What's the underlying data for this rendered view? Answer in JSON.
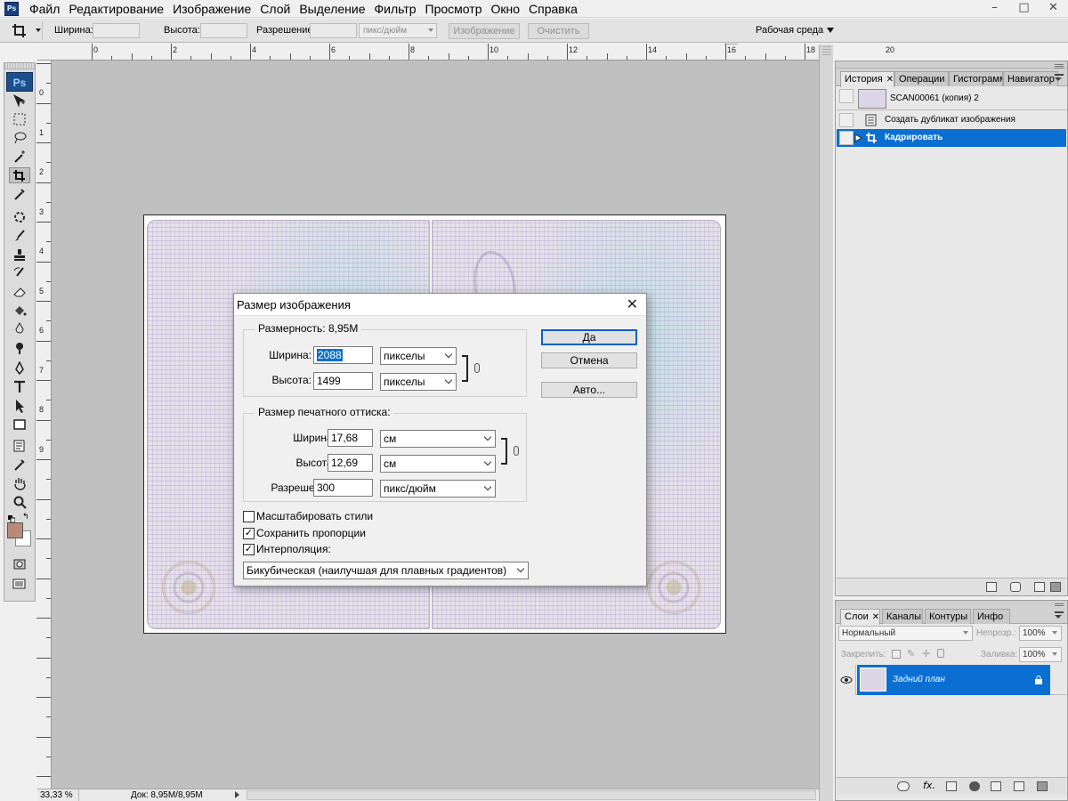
{
  "menubar": {
    "items": [
      "Файл",
      "Редактирование",
      "Изображение",
      "Слой",
      "Выделение",
      "Фильтр",
      "Просмотр",
      "Окно",
      "Справка"
    ],
    "win_minimize": "–",
    "win_restore": "□",
    "win_close": "✕"
  },
  "options": {
    "width_label": "Ширина:",
    "height_label": "Высота:",
    "resolution_label": "Разрешение:",
    "resolution_unit": "пикс/дюйм",
    "image_button": "Изображение",
    "clear_button": "Очистить",
    "workspace": "Рабочая среда"
  },
  "ruler": {
    "top_numbers": [
      "0",
      "2",
      "4",
      "6",
      "8",
      "10",
      "12",
      "14",
      "16",
      "18",
      "20"
    ],
    "left_numbers": [
      "0",
      "1",
      "2",
      "3",
      "4",
      "5",
      "6",
      "7",
      "8",
      "9"
    ]
  },
  "status": {
    "zoom": "33,33 %",
    "doc": "Док: 8,95M/8,95M"
  },
  "history": {
    "tabs": [
      "История",
      "Операции",
      "Гистограмма",
      "Навигатор"
    ],
    "snapshot": "SCAN00061 (копия) 2",
    "steps": [
      "Создать дубликат изображения",
      "Кадрировать"
    ]
  },
  "layers": {
    "tabs": [
      "Слои",
      "Каналы",
      "Контуры",
      "Инфо"
    ],
    "blend_mode": "Нормальный",
    "opacity_label": "Непрозр.:",
    "opacity": "100%",
    "lock_label": "Закрепить:",
    "fill_label": "Заливка:",
    "fill": "100%",
    "layer_name": "Задний план"
  },
  "dialog": {
    "title": "Размер изображения",
    "dimensions_label": "Размерность:",
    "dimensions_size": "8,95M",
    "pixel_width_label": "Ширина:",
    "pixel_width": "2088",
    "pixel_width_unit": "пикселы",
    "pixel_height_label": "Высота:",
    "pixel_height": "1499",
    "pixel_height_unit": "пикселы",
    "print_group": "Размер печатного оттиска:",
    "doc_width_label": "Ширина:",
    "doc_width": "17,68",
    "doc_width_unit": "см",
    "doc_height_label": "Высота:",
    "doc_height": "12,69",
    "doc_height_unit": "см",
    "resolution_label": "Разрешение:",
    "resolution": "300",
    "resolution_unit": "пикс/дюйм",
    "scale_styles": "Масштабировать стили",
    "constrain": "Сохранить пропорции",
    "resample": "Интерполяция:",
    "resample_method": "Бикубическая (наилучшая для плавных градиентов)",
    "ok": "Да",
    "cancel": "Отмена",
    "auto": "Авто...",
    "check_mark": "✓"
  },
  "toolbox": {
    "badge": "Ps"
  },
  "colors": {
    "accent": "#0a6fd1",
    "foreground_swatch": "#b98a7a"
  }
}
